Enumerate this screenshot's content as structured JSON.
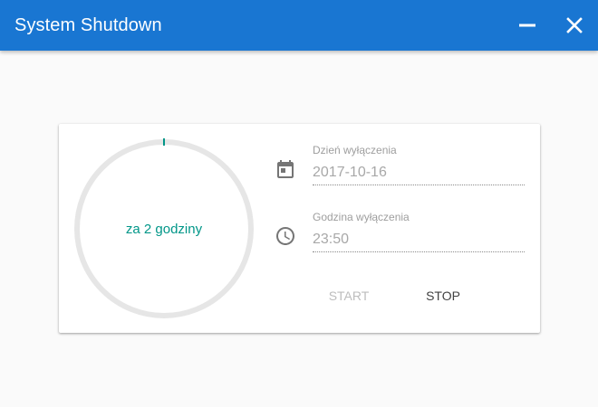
{
  "window": {
    "title": "System Shutdown",
    "accent_color": "#1976d2"
  },
  "timer": {
    "remaining_label": "za 2 godziny",
    "progress_fraction": 0.0,
    "progress_color": "#009688",
    "track_color": "#e6e6e6"
  },
  "date_field": {
    "label": "Dzień wyłączenia",
    "value": "2017-10-16",
    "icon": "calendar-icon"
  },
  "time_field": {
    "label": "Godzina wyłączenia",
    "value": "23:50",
    "icon": "clock-icon"
  },
  "actions": {
    "start_label": "START",
    "stop_label": "STOP"
  }
}
